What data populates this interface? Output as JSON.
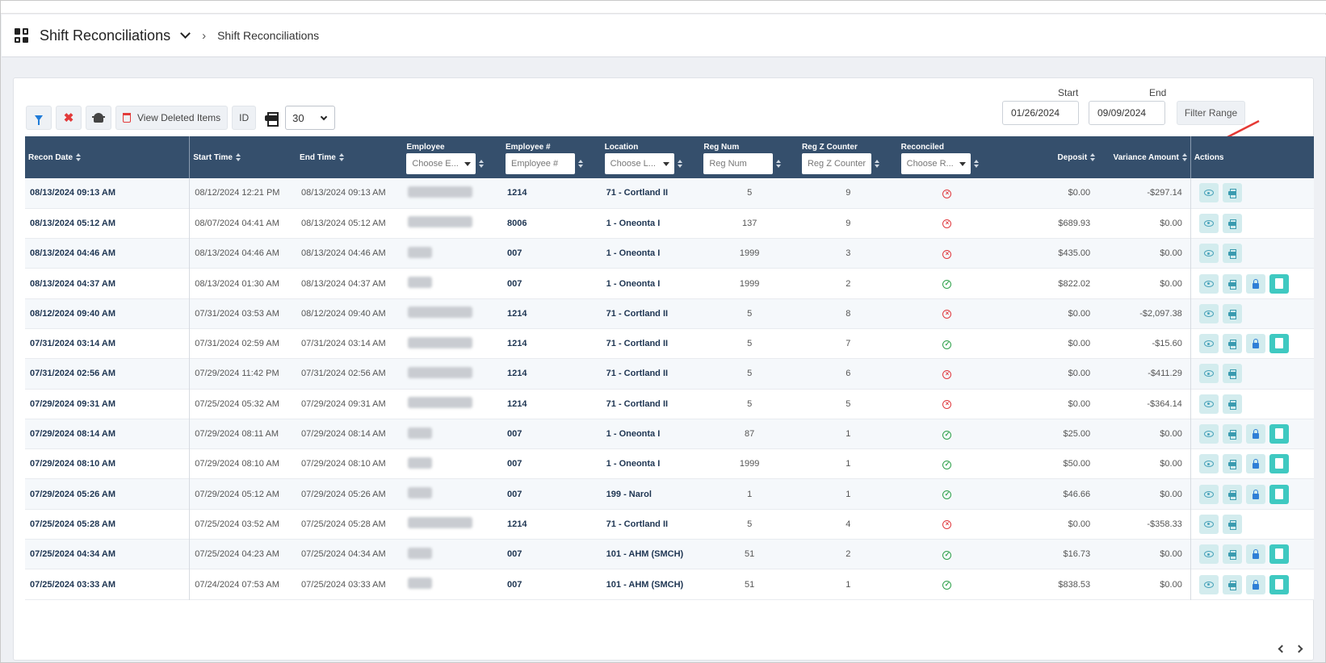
{
  "header": {
    "title": "Shift Reconciliations",
    "breadcrumb": "Shift Reconciliations"
  },
  "toolbar": {
    "view_deleted_label": "View Deleted Items",
    "id_label": "ID",
    "page_size": "30"
  },
  "date_range": {
    "start_label": "Start",
    "end_label": "End",
    "start_value": "01/26/2024",
    "end_value": "09/09/2024",
    "filter_label": "Filter Range"
  },
  "columns": {
    "recon_date": "Recon Date",
    "start_time": "Start Time",
    "end_time": "End Time",
    "employee": "Employee",
    "employee_placeholder": "Choose E...",
    "employee_num": "Employee #",
    "employee_num_placeholder": "Employee #",
    "location": "Location",
    "location_placeholder": "Choose L...",
    "reg_num": "Reg Num",
    "reg_num_placeholder": "Reg Num",
    "reg_z": "Reg Z Counter",
    "reg_z_placeholder": "Reg Z Counter",
    "reconciled": "Reconciled",
    "reconciled_placeholder": "Choose R...",
    "deposit": "Deposit",
    "variance": "Variance Amount",
    "actions": "Actions"
  },
  "rows": [
    {
      "recon": "08/13/2024 09:13 AM",
      "start": "08/12/2024 12:21 PM",
      "end": "08/13/2024 09:13 AM",
      "emp_num": "1214",
      "location": "71 - Cortland II",
      "reg": "5",
      "z": "9",
      "reconciled": false,
      "deposit": "$0.00",
      "variance": "-$297.14"
    },
    {
      "recon": "08/13/2024 05:12 AM",
      "start": "08/07/2024 04:41 AM",
      "end": "08/13/2024 05:12 AM",
      "emp_num": "8006",
      "location": "1 - Oneonta I",
      "reg": "137",
      "z": "9",
      "reconciled": false,
      "deposit": "$689.93",
      "variance": "$0.00"
    },
    {
      "recon": "08/13/2024 04:46 AM",
      "start": "08/13/2024 04:46 AM",
      "end": "08/13/2024 04:46 AM",
      "emp_num": "007",
      "location": "1 - Oneonta I",
      "reg": "1999",
      "z": "3",
      "reconciled": false,
      "deposit": "$435.00",
      "variance": "$0.00"
    },
    {
      "recon": "08/13/2024 04:37 AM",
      "start": "08/13/2024 01:30 AM",
      "end": "08/13/2024 04:37 AM",
      "emp_num": "007",
      "location": "1 - Oneonta I",
      "reg": "1999",
      "z": "2",
      "reconciled": true,
      "deposit": "$822.02",
      "variance": "$0.00"
    },
    {
      "recon": "08/12/2024 09:40 AM",
      "start": "07/31/2024 03:53 AM",
      "end": "08/12/2024 09:40 AM",
      "emp_num": "1214",
      "location": "71 - Cortland II",
      "reg": "5",
      "z": "8",
      "reconciled": false,
      "deposit": "$0.00",
      "variance": "-$2,097.38"
    },
    {
      "recon": "07/31/2024 03:14 AM",
      "start": "07/31/2024 02:59 AM",
      "end": "07/31/2024 03:14 AM",
      "emp_num": "1214",
      "location": "71 - Cortland II",
      "reg": "5",
      "z": "7",
      "reconciled": true,
      "deposit": "$0.00",
      "variance": "-$15.60"
    },
    {
      "recon": "07/31/2024 02:56 AM",
      "start": "07/29/2024 11:42 PM",
      "end": "07/31/2024 02:56 AM",
      "emp_num": "1214",
      "location": "71 - Cortland II",
      "reg": "5",
      "z": "6",
      "reconciled": false,
      "deposit": "$0.00",
      "variance": "-$411.29"
    },
    {
      "recon": "07/29/2024 09:31 AM",
      "start": "07/25/2024 05:32 AM",
      "end": "07/29/2024 09:31 AM",
      "emp_num": "1214",
      "location": "71 - Cortland II",
      "reg": "5",
      "z": "5",
      "reconciled": false,
      "deposit": "$0.00",
      "variance": "-$364.14"
    },
    {
      "recon": "07/29/2024 08:14 AM",
      "start": "07/29/2024 08:11 AM",
      "end": "07/29/2024 08:14 AM",
      "emp_num": "007",
      "location": "1 - Oneonta I",
      "reg": "87",
      "z": "1",
      "reconciled": true,
      "deposit": "$25.00",
      "variance": "$0.00"
    },
    {
      "recon": "07/29/2024 08:10 AM",
      "start": "07/29/2024 08:10 AM",
      "end": "07/29/2024 08:10 AM",
      "emp_num": "007",
      "location": "1 - Oneonta I",
      "reg": "1999",
      "z": "1",
      "reconciled": true,
      "deposit": "$50.00",
      "variance": "$0.00"
    },
    {
      "recon": "07/29/2024 05:26 AM",
      "start": "07/29/2024 05:12 AM",
      "end": "07/29/2024 05:26 AM",
      "emp_num": "007",
      "location": "199 - Narol",
      "reg": "1",
      "z": "1",
      "reconciled": true,
      "deposit": "$46.66",
      "variance": "$0.00"
    },
    {
      "recon": "07/25/2024 05:28 AM",
      "start": "07/25/2024 03:52 AM",
      "end": "07/25/2024 05:28 AM",
      "emp_num": "1214",
      "location": "71 - Cortland II",
      "reg": "5",
      "z": "4",
      "reconciled": false,
      "deposit": "$0.00",
      "variance": "-$358.33"
    },
    {
      "recon": "07/25/2024 04:34 AM",
      "start": "07/25/2024 04:23 AM",
      "end": "07/25/2024 04:34 AM",
      "emp_num": "007",
      "location": "101 - AHM (SMCH)",
      "reg": "51",
      "z": "2",
      "reconciled": true,
      "deposit": "$16.73",
      "variance": "$0.00"
    },
    {
      "recon": "07/25/2024 03:33 AM",
      "start": "07/24/2024 07:53 AM",
      "end": "07/25/2024 03:33 AM",
      "emp_num": "007",
      "location": "101 - AHM (SMCH)",
      "reg": "51",
      "z": "1",
      "reconciled": true,
      "deposit": "$838.53",
      "variance": "$0.00"
    }
  ],
  "colors": {
    "header_bg": "#354f6c",
    "accent": "#1f7bd8",
    "danger": "#e0393e",
    "success": "#2ea14a",
    "doc_button": "#3fc9c1"
  },
  "icons": {
    "app": "grid-icon",
    "view": "eye-icon",
    "print": "print-icon",
    "unlock": "unlock-icon",
    "document": "document-icon"
  }
}
